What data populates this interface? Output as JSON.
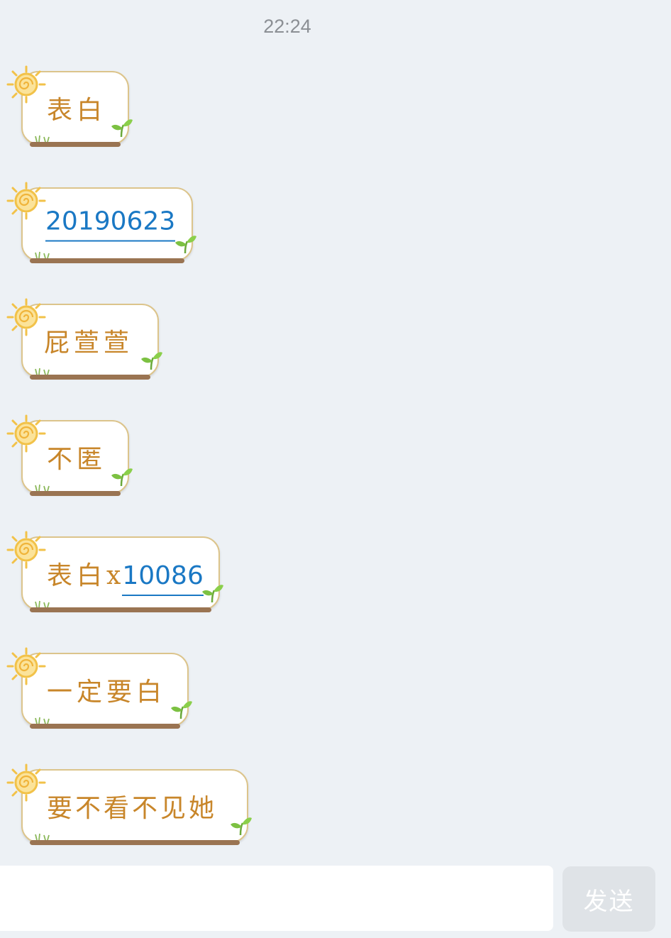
{
  "header": {
    "time": "22:24"
  },
  "messages": [
    {
      "text": "表白"
    },
    {
      "link": "20190623"
    },
    {
      "text": "屁萱萱"
    },
    {
      "text": "不匿"
    },
    {
      "text": "表白",
      "x": "x",
      "link": "10086"
    },
    {
      "text": "一定要白"
    },
    {
      "text": "要不看不见她"
    }
  ],
  "composer": {
    "input_value": "",
    "send_label": "发送"
  },
  "colors": {
    "background": "#edf1f5",
    "bubble_border": "#dcc48b",
    "text_orange": "#c8862a",
    "link_blue": "#1a78c4",
    "sprout_green": "#7cc142",
    "sun_yellow": "#f2c249"
  },
  "icons": {
    "sun": "sun-icon",
    "sprout": "sprout-icon",
    "grass": "grass-icon"
  }
}
